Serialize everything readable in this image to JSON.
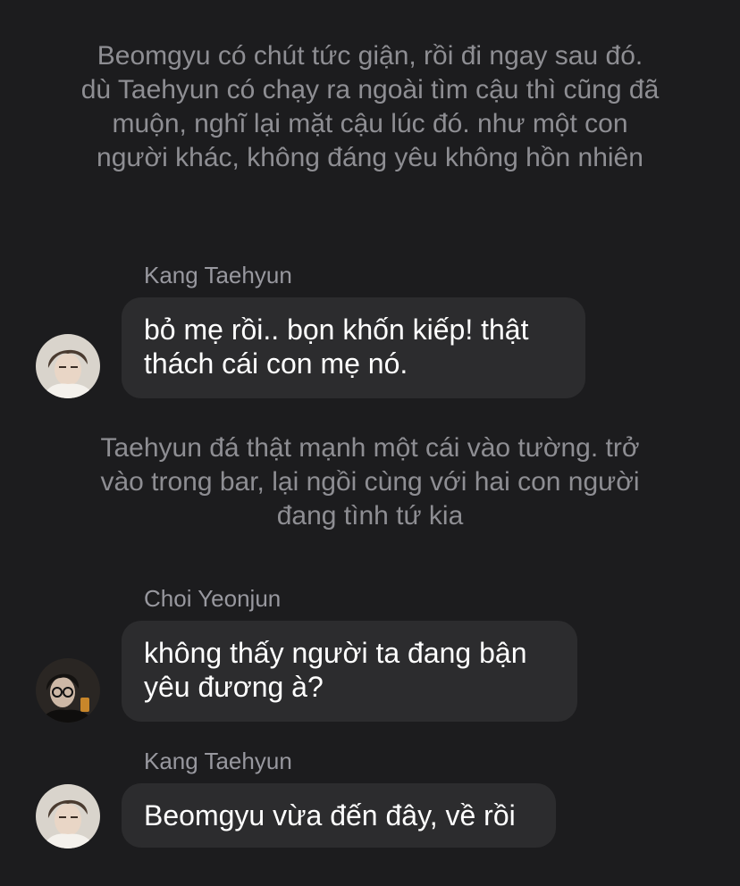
{
  "chat": {
    "narration_1": "Beomgyu có chút tức giận, rồi đi ngay sau đó. dù Taehyun có chạy ra ngoài tìm cậu thì cũng đã muộn, nghĩ lại mặt cậu lúc đó. như một con người khác, không đáng yêu không hồn nhiên",
    "narration_2": "Taehyun đá thật mạnh một cái vào tường. trở vào trong bar, lại ngồi cùng với hai con người đang tình tứ kia",
    "messages": [
      {
        "sender": "Kang Taehyun",
        "text": "bỏ mẹ rồi.. bọn khốn kiếp! thật thách cái con mẹ nó.",
        "avatar_icon": "taehyun-avatar"
      },
      {
        "sender": "Choi Yeonjun",
        "text": "không thấy người ta đang bận yêu đương à?",
        "avatar_icon": "yeonjun-avatar"
      },
      {
        "sender": "Kang Taehyun",
        "text": "Beomgyu vừa đến đây, về rồi",
        "avatar_icon": "taehyun-avatar"
      }
    ]
  },
  "colors": {
    "background": "#1c1c1e",
    "bubble": "#2c2c2e",
    "narration_text": "#8e8e93",
    "sender_text": "#98989f",
    "message_text": "#ffffff"
  }
}
